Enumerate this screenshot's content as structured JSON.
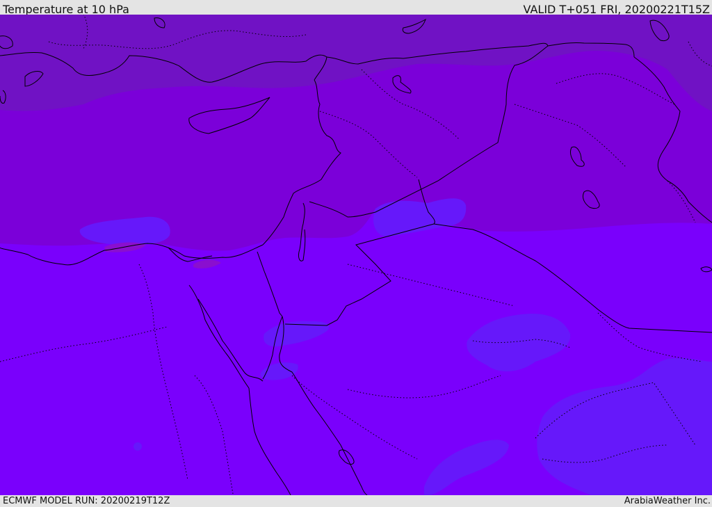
{
  "header": {
    "title": "Temperature at 10 hPa",
    "valid": "VALID T+051 FRI, 20200221T15Z"
  },
  "footer": {
    "model_run": "ECMWF MODEL RUN: 20200219T12Z",
    "provider": "ArabiaWeather Inc."
  },
  "colors": {
    "band_north": "#7012c4",
    "band_mid": "#7b00d9",
    "band_south": "#7a00fc",
    "cool_patch": "#6618fa",
    "cold_patch": "#8020f0",
    "warm_patch": "#8a0fcf",
    "coastline": "#000000"
  }
}
